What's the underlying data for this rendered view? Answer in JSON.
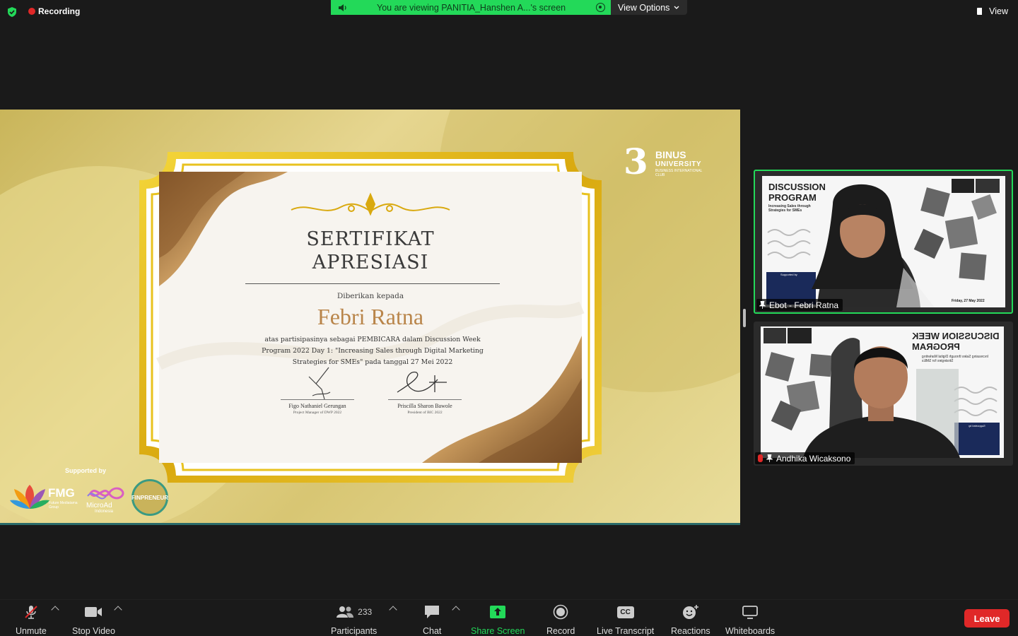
{
  "top_bar": {
    "recording_label": "Recording",
    "share_banner": "You are viewing PANITIA_Hanshen A...'s screen",
    "view_options_label": "View Options",
    "view_label": "View"
  },
  "shared_screen": {
    "binus": {
      "mark": "3",
      "line1": "BINUS",
      "line2": "UNIVERSITY",
      "line3": "BUSINESS INTERNATIONAL CLUB"
    },
    "supported_by_label": "Supported by",
    "fmg_label": "FMG",
    "fmg_sub": "Future Mediatama Group",
    "microad_label": "MicroAd",
    "microad_sub": "Indonesia",
    "finpreneur_label": "FINPRENEUR",
    "certificate": {
      "title_line1": "SERTIFIKAT",
      "title_line2": "APRESIASI",
      "given_to": "Diberikan kepada",
      "recipient": "Febri Ratna",
      "body": "atas partisipasinya sebagai PEMBICARA dalam Discussion Week Program 2022 Day 1: \"Increasing Sales through Digital Marketing Strategies for SMEs\" pada tanggal 27 Mei 2022",
      "signer1_name": "Figo Nathaniel Gerungan",
      "signer1_role": "Project Manager of DWP 2022",
      "signer2_name": "Priscilla Sharon Bawole",
      "signer2_role": "President of BIC 2022"
    }
  },
  "participants_panel": [
    {
      "name": "Ebot - Febri Ratna",
      "slide_title": "DISCUSSION PROGRAM",
      "slide_sub": "Increasing Sales through Strategies for SMEs",
      "slide_date": "Friday, 27 May 2022",
      "slide_supported": "Supported by",
      "active_speaker": true
    },
    {
      "name": "Andhika Wicaksono",
      "slide_title_line1": "DISCUSSION WEEK",
      "slide_title_line2": "PROGRAM",
      "slide_sub": "Increasing Sales through Digital Marketing Strategies for SMEs",
      "slide_supported": "Supported by",
      "muted": true
    }
  ],
  "toolbar": {
    "unmute_label": "Unmute",
    "stop_video_label": "Stop Video",
    "participants_label": "Participants",
    "participants_count": "233",
    "chat_label": "Chat",
    "share_screen_label": "Share Screen",
    "record_label": "Record",
    "live_transcript_label": "Live Transcript",
    "cc_icon_text": "CC",
    "reactions_label": "Reactions",
    "whiteboards_label": "Whiteboards",
    "leave_label": "Leave"
  },
  "colors": {
    "zoom_green": "#23d959",
    "leave_red": "#e02828",
    "certificate_gold": "#e8c21f",
    "recipient_brown": "#b9854a"
  }
}
